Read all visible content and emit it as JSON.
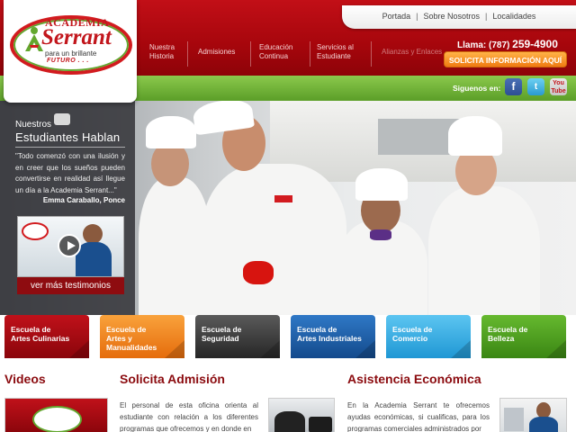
{
  "header": {
    "top_links": [
      "Portada",
      "Sobre Nosotros",
      "Localidades"
    ],
    "logo": {
      "academia": "ACADEMIA",
      "serrant": "Serrant",
      "tagline": "para un brillante",
      "futuro": "FUTURO . . ."
    },
    "nav": [
      "Nuestra Historia",
      "Admisiones",
      "Educación Continua",
      "Servicios al Estudiante",
      "Alianzas y Enlaces"
    ],
    "phone_label": "Llama:",
    "phone_area": "(787)",
    "phone_number": "259-4900",
    "cta": "SOLICITA INFORMACIÓN AQUÍ",
    "siguenos": "Siguenos en:",
    "social": [
      "facebook-icon",
      "twitter-icon",
      "youtube-icon"
    ]
  },
  "testimonials": {
    "heading_small": "Nuestros",
    "heading_big": "Estudiantes Hablan",
    "quote": "\"Todo comenzó con una ilusión y en creer que los sueños pueden convertirse en realidad así llegue un día a la Academia Serrant...\"",
    "author": "Emma Caraballo, Ponce",
    "more_button": "ver más testimonios"
  },
  "schools": [
    {
      "line1": "Escuela de",
      "line2": "Artes Culinarias",
      "color": "#a3080f"
    },
    {
      "line1": "Escuela de",
      "line2": "Artes y Manualidades",
      "color": "#f08419"
    },
    {
      "line1": "Escuela de",
      "line2": "Seguridad",
      "color": "#3d3d3d"
    },
    {
      "line1": "Escuela de",
      "line2": "Artes Industriales",
      "color": "#1d5ea8"
    },
    {
      "line1": "Escuela de",
      "line2": "Comercio",
      "color": "#36aee6"
    },
    {
      "line1": "Escuela de",
      "line2": "Belleza",
      "color": "#4b9e1f"
    }
  ],
  "sections": {
    "videos_title": "Videos",
    "admision_title": "Solicita Admisión",
    "admision_text": "El personal de esta oficina orienta al estudiante con relación a los diferentes programas que ofrecemos y en donde en",
    "asistencia_title": "Asistencia Económica",
    "asistencia_text": "En la Academia Serrant te ofrecemos ayudas económicas, si cualificas, para los programas comerciales administrados por"
  },
  "colors": {
    "brand_red": "#a6060c",
    "brand_green": "#5b9e28",
    "cta_orange": "#f07b12"
  }
}
